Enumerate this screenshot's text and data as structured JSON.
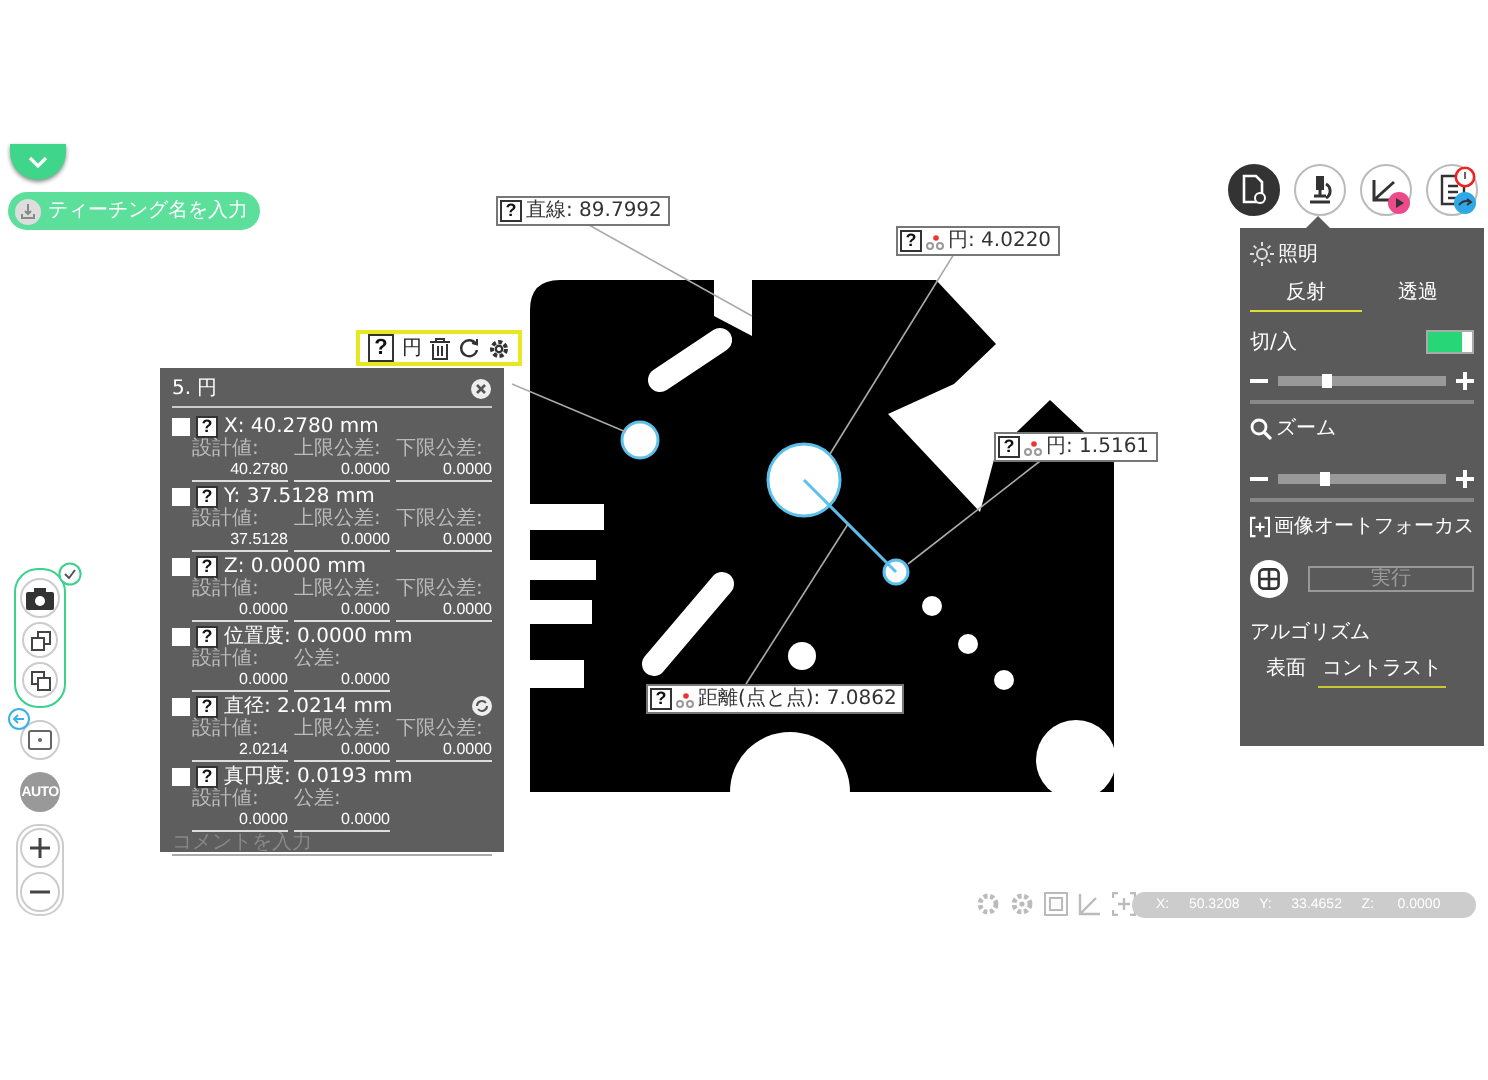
{
  "teaching_name": {
    "placeholder": "ティーチング名を入力"
  },
  "feature_toolbar": {
    "help": "?",
    "label": "円"
  },
  "feature_panel": {
    "title": "5. 円",
    "rows": [
      {
        "checked": false,
        "help": "?",
        "label": "X: 40.2780 mm",
        "sync": false,
        "fields": [
          {
            "label": "設計値:",
            "value": "40.2780"
          },
          {
            "label": "上限公差:",
            "value": "0.0000"
          },
          {
            "label": "下限公差:",
            "value": "0.0000"
          }
        ]
      },
      {
        "checked": false,
        "help": "?",
        "label": "Y: 37.5128 mm",
        "sync": false,
        "fields": [
          {
            "label": "設計値:",
            "value": "37.5128"
          },
          {
            "label": "上限公差:",
            "value": "0.0000"
          },
          {
            "label": "下限公差:",
            "value": "0.0000"
          }
        ]
      },
      {
        "checked": false,
        "help": "?",
        "label": "Z: 0.0000 mm",
        "sync": false,
        "fields": [
          {
            "label": "設計値:",
            "value": "0.0000"
          },
          {
            "label": "上限公差:",
            "value": "0.0000"
          },
          {
            "label": "下限公差:",
            "value": "0.0000"
          }
        ]
      },
      {
        "checked": false,
        "help": "?",
        "label": "位置度: 0.0000 mm",
        "sync": false,
        "fields": [
          {
            "label": "設計値:",
            "value": "0.0000"
          },
          {
            "label": "公差:",
            "value": "0.0000"
          }
        ]
      },
      {
        "checked": false,
        "help": "?",
        "label": "直径: 2.0214 mm",
        "sync": true,
        "fields": [
          {
            "label": "設計値:",
            "value": "2.0214"
          },
          {
            "label": "上限公差:",
            "value": "0.0000"
          },
          {
            "label": "下限公差:",
            "value": "0.0000"
          }
        ]
      },
      {
        "checked": false,
        "help": "?",
        "label": "真円度: 0.0193 mm",
        "sync": false,
        "fields": [
          {
            "label": "設計値:",
            "value": "0.0000"
          },
          {
            "label": "公差:",
            "value": "0.0000"
          }
        ]
      }
    ],
    "comment": {
      "placeholder": "コメントを入力"
    }
  },
  "annotations": [
    {
      "help": "?",
      "label": "直線: 89.7992",
      "tool": false
    },
    {
      "help": "?",
      "label": "円: 4.0220",
      "tool": true
    },
    {
      "help": "?",
      "label": "円: 1.5161",
      "tool": true
    },
    {
      "help": "?",
      "label": "距離(点と点): 7.0862",
      "tool": true
    }
  ],
  "light_panel": {
    "title": "照明",
    "tabs": [
      {
        "label": "反射",
        "selected": true
      },
      {
        "label": "透過",
        "selected": false
      }
    ],
    "switch": {
      "label": "切/入",
      "on": true
    },
    "brightness": {
      "level": 0.3
    },
    "zoom": {
      "title": "ズーム",
      "level": 0.28
    },
    "autofocus": {
      "title": "画像オートフォーカス",
      "button": "実行"
    },
    "algorithm": {
      "title": "アルゴリズム",
      "options": [
        {
          "label": "表面",
          "selected": false
        },
        {
          "label": "コントラスト",
          "selected": true
        }
      ]
    }
  },
  "auto_button": "AUTO",
  "coordinates": [
    {
      "axis": "X:",
      "value": "50.3208"
    },
    {
      "axis": "Y:",
      "value": "33.4652"
    },
    {
      "axis": "Z:",
      "value": "0.0000"
    }
  ]
}
